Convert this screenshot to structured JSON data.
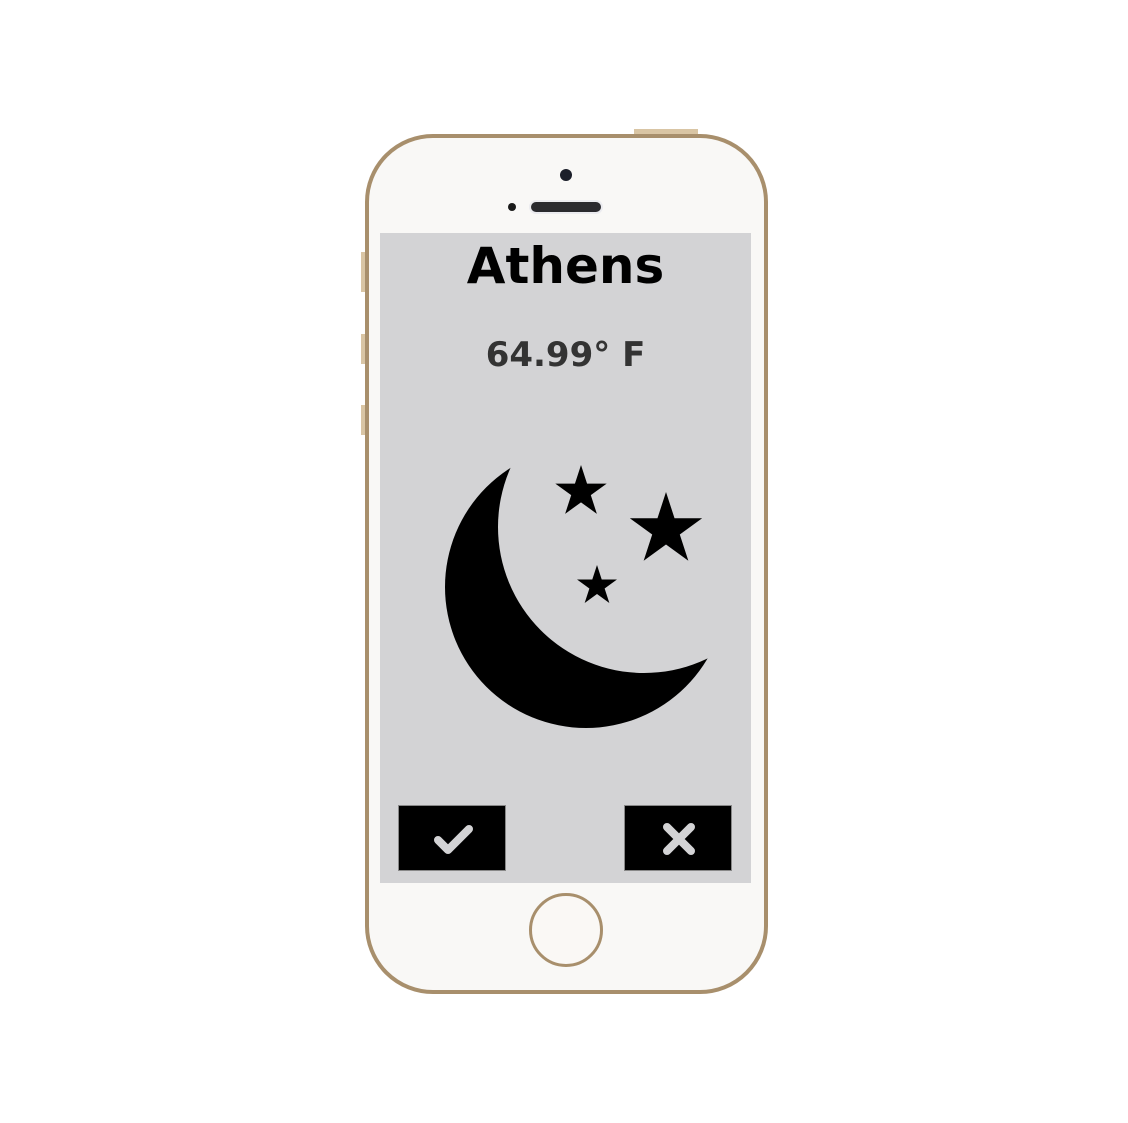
{
  "weather": {
    "city": "Athens",
    "temperature": "64.99° F",
    "condition_icon": "moon-stars-icon"
  },
  "actions": {
    "confirm_icon": "check-icon",
    "cancel_icon": "close-icon"
  },
  "colors": {
    "frame": "#a88f6c",
    "screen_bg": "#d3d3d5",
    "button_bg": "#000000",
    "button_icon": "#d3d3d5"
  }
}
